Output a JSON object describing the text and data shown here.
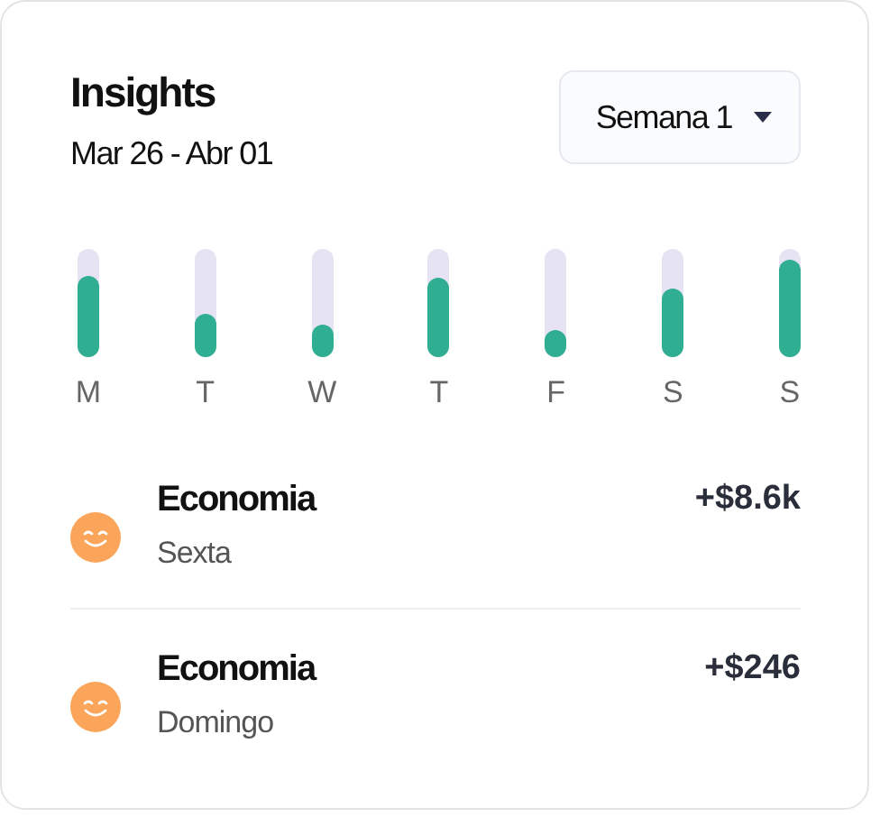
{
  "header": {
    "title": "Insights",
    "date_range": "Mar 26 - Abr 01"
  },
  "week_select": {
    "value": "Semana 1"
  },
  "days": [
    {
      "label": "M",
      "level": 0.75
    },
    {
      "label": "T",
      "level": 0.4
    },
    {
      "label": "W",
      "level": 0.3
    },
    {
      "label": "T",
      "level": 0.73
    },
    {
      "label": "F",
      "level": 0.25
    },
    {
      "label": "S",
      "level": 0.63
    },
    {
      "label": "S",
      "level": 0.9
    }
  ],
  "entries": [
    {
      "title": "Economia",
      "day": "Sexta",
      "amount": "+$8.6k"
    },
    {
      "title": "Economia",
      "day": "Domingo",
      "amount": "+$246"
    }
  ]
}
